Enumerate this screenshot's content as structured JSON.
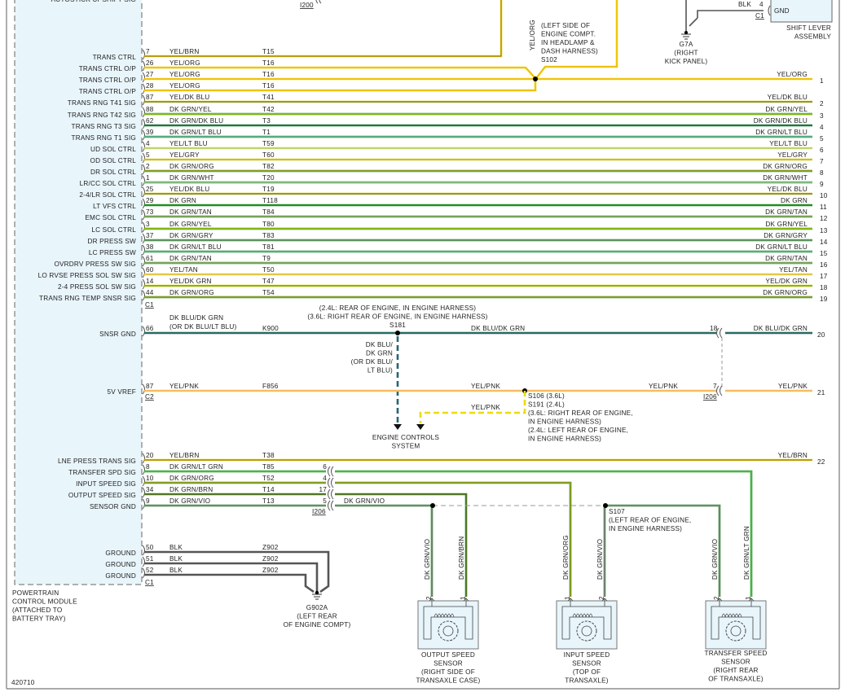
{
  "colors": {
    "YEL": "#ecdc00",
    "ORG": "#f5a623",
    "BRN": "#8b5a2b",
    "DK BLU": "#2a4f8f",
    "DK GRN": "#1f8f1f",
    "LT BLU": "#8ecae6",
    "GRY": "#9a9a9a",
    "WHT": "#e0e0e0",
    "TAN": "#d2b48c",
    "LT GRN": "#6fdc6f",
    "VIO": "#d070d0",
    "PNK": "#ff9ccc",
    "BLK": "#555555",
    "module_fill": "#e8f5fb"
  },
  "top": {
    "cut_label": "AUTOSTICK UPSHIFT SIG",
    "connector_i200": "I200",
    "splice_s102_note": [
      "(LEFT SIDE OF",
      "ENGINE COMPT.",
      "IN HEADLAMP &",
      "DASH HARNESS)",
      "S102"
    ],
    "vertical_color": "YEL/ORG",
    "ground_g7a": [
      "G7A",
      "(RIGHT",
      "KICK PANEL)"
    ],
    "shift_lever": {
      "wire_color": "BLK",
      "pin": "4",
      "pin_label": "GND",
      "connector": "C1",
      "name": [
        "SHIFT LEVER",
        "ASSEMBLY"
      ]
    }
  },
  "pcm": {
    "name": [
      "POWERTRAIN",
      "CONTROL MODULE",
      "(ATTACHED TO",
      "BATTERY TRAY)"
    ],
    "rows": [
      {
        "label": "TRANS CTRL",
        "pin": "7",
        "color": "YEL/BRN",
        "circuit": "T15"
      },
      {
        "label": "TRANS CTRL O/P",
        "pin": "26",
        "color": "YEL/ORG",
        "circuit": "T16"
      },
      {
        "label": "TRANS CTRL O/P",
        "pin": "27",
        "color": "YEL/ORG",
        "circuit": "T16",
        "right_color": "YEL/ORG",
        "right_num": "1"
      },
      {
        "label": "TRANS CTRL O/P",
        "pin": "28",
        "color": "YEL/ORG",
        "circuit": "T16"
      },
      {
        "label": "TRANS RNG T41 SIG",
        "pin": "87",
        "color": "YEL/DK BLU",
        "circuit": "T41",
        "right_color": "YEL/DK BLU",
        "right_num": "2"
      },
      {
        "label": "TRANS RNG T42 SIG",
        "pin": "88",
        "color": "DK GRN/YEL",
        "circuit": "T42",
        "right_color": "DK GRN/YEL",
        "right_num": "3"
      },
      {
        "label": "TRANS RNG T3 SIG",
        "pin": "62",
        "color": "DK GRN/DK BLU",
        "circuit": "T3",
        "right_color": "DK GRN/DK BLU",
        "right_num": "4"
      },
      {
        "label": "TRANS RNG T1 SIG",
        "pin": "39",
        "color": "DK GRN/LT BLU",
        "circuit": "T1",
        "right_color": "DK GRN/LT BLU",
        "right_num": "5"
      },
      {
        "label": "UD SOL CTRL",
        "pin": "4",
        "color": "YEL/LT BLU",
        "circuit": "T59",
        "right_color": "YEL/LT BLU",
        "right_num": "6"
      },
      {
        "label": "OD SOL CTRL",
        "pin": "5",
        "color": "YEL/GRY",
        "circuit": "T60",
        "right_color": "YEL/GRY",
        "right_num": "7"
      },
      {
        "label": "DR SOL CTRL",
        "pin": "2",
        "color": "DK GRN/ORG",
        "circuit": "T82",
        "right_color": "DK GRN/ORG",
        "right_num": "8"
      },
      {
        "label": "LR/CC SOL CTRL",
        "pin": "1",
        "color": "DK GRN/WHT",
        "circuit": "T20",
        "right_color": "DK GRN/WHT",
        "right_num": "9"
      },
      {
        "label": "2-4/LR SOL CTRL",
        "pin": "25",
        "color": "YEL/DK BLU",
        "circuit": "T19",
        "right_color": "YEL/DK BLU",
        "right_num": "10"
      },
      {
        "label": "LT VFS CTRL",
        "pin": "29",
        "color": "DK GRN",
        "circuit": "T118",
        "right_color": "DK GRN",
        "right_num": "11"
      },
      {
        "label": "EMC SOL CTRL",
        "pin": "73",
        "color": "DK GRN/TAN",
        "circuit": "T84",
        "right_color": "DK GRN/TAN",
        "right_num": "12"
      },
      {
        "label": "LC SOL CTRL",
        "pin": "3",
        "color": "DK GRN/YEL",
        "circuit": "T80",
        "right_color": "DK GRN/YEL",
        "right_num": "13"
      },
      {
        "label": "DR PRESS SW",
        "pin": "37",
        "color": "DK GRN/GRY",
        "circuit": "T83",
        "right_color": "DK GRN/GRY",
        "right_num": "14"
      },
      {
        "label": "LC PRESS SW",
        "pin": "38",
        "color": "DK GRN/LT BLU",
        "circuit": "T81",
        "right_color": "DK GRN/LT BLU",
        "right_num": "15"
      },
      {
        "label": "OVRDRV PRESS SW SIG",
        "pin": "61",
        "color": "DK GRN/TAN",
        "circuit": "T9",
        "right_color": "DK GRN/TAN",
        "right_num": "16"
      },
      {
        "label": "LO RVSE PRESS SOL SW SIG",
        "pin": "60",
        "color": "YEL/TAN",
        "circuit": "T50",
        "right_color": "YEL/TAN",
        "right_num": "17"
      },
      {
        "label": "2-4 PRESS SOL SW SIG",
        "pin": "14",
        "color": "YEL/DK GRN",
        "circuit": "T47",
        "right_color": "YEL/DK GRN",
        "right_num": "18"
      },
      {
        "label": "TRANS RNG TEMP SNSR SIG",
        "pin": "44",
        "color": "DK GRN/ORG",
        "circuit": "T54",
        "right_color": "DK GRN/ORG",
        "right_num": "19"
      }
    ],
    "connector_c1": "C1",
    "connector_c2": "C2"
  },
  "snsr_gnd": {
    "label": "SNSR GND",
    "pin": "66",
    "color": "DK BLU/DK GRN",
    "alt_color": "(OR DK BLU/LT BLU)",
    "circuit": "K900",
    "splice_note": [
      "(2.4L: REAR OF ENGINE, IN ENGINE HARNESS)",
      "(3.6L: RIGHT REAR OF ENGINE, IN ENGINE HARNESS)",
      "S181"
    ],
    "mid_color": "DK BLU/DK GRN",
    "inline_pin": "18",
    "right_color": "DK BLU/DK GRN",
    "right_num": "20",
    "branch_color": [
      "DK BLU/",
      "DK GRN",
      "(OR DK BLU/",
      "LT BLU)"
    ]
  },
  "vref": {
    "label": "5V VREF",
    "pin": "87",
    "color": "YEL/PNK",
    "circuit": "F856",
    "mid_color": "YEL/PNK",
    "mid_color2": "YEL/PNK",
    "branch_color": "YEL/PNK",
    "inline_pin": "7",
    "connector": "I206",
    "right_color": "YEL/PNK",
    "right_num": "21",
    "splice_note": [
      "S106  (3.6L)",
      "S191  (2.4L)",
      "(3.6L: RIGHT REAR OF ENGINE,",
      "IN ENGINE HARNESS)",
      "(2.4L: LEFT REAR OF ENGINE,",
      "IN ENGINE HARNESS)"
    ]
  },
  "engine_controls": [
    "ENGINE CONTROLS",
    "SYSTEM"
  ],
  "speed": {
    "rows": [
      {
        "label": "LNE PRESS TRANS SIG",
        "pin": "20",
        "color": "YEL/BRN",
        "circuit": "T38",
        "right_color": "YEL/BRN",
        "right_num": "22"
      },
      {
        "label": "TRANSFER SPD SIG",
        "pin": "8",
        "color": "DK GRN/LT GRN",
        "circuit": "T85",
        "inline_pin": "6"
      },
      {
        "label": "INPUT SPEED SIG",
        "pin": "10",
        "color": "DK GRN/ORG",
        "circuit": "T52",
        "inline_pin": "4"
      },
      {
        "label": "OUTPUT SPEED SIG",
        "pin": "34",
        "color": "DK GRN/BRN",
        "circuit": "T14",
        "inline_pin": "17"
      },
      {
        "label": "SENSOR GND",
        "pin": "9",
        "color": "DK GRN/VIO",
        "circuit": "T13",
        "inline_pin": "5",
        "after_color": "DK GRN/VIO"
      }
    ],
    "connector": "I206",
    "splice_s107": [
      "S107",
      "(LEFT REAR OF ENGINE,",
      "IN ENGINE HARNESS)"
    ]
  },
  "grounds": {
    "rows": [
      {
        "label": "GROUND",
        "pin": "50",
        "color": "BLK",
        "circuit": "Z902"
      },
      {
        "label": "GROUND",
        "pin": "51",
        "color": "BLK",
        "circuit": "Z902"
      },
      {
        "label": "GROUND",
        "pin": "52",
        "color": "BLK",
        "circuit": "Z902"
      }
    ],
    "connector": "C1",
    "ground_name": [
      "G902A",
      "(LEFT REAR",
      "OF ENGINE COMPT)"
    ]
  },
  "sensors": [
    {
      "name": [
        "OUTPUT SPEED",
        "SENSOR",
        "(RIGHT SIDE OF",
        "TRANSAXLE CASE)"
      ],
      "left_pin": "2",
      "left_color": "DK GRN/VIO",
      "right_pin": "1",
      "right_color": "DK GRN/BRN"
    },
    {
      "name": [
        "INPUT SPEED",
        "SENSOR",
        "(TOP OF",
        "TRANSAXLE)"
      ],
      "left_pin": "1",
      "left_color": "DK GRN/ORG",
      "right_pin": "2",
      "right_color": "DK GRN/VIO"
    },
    {
      "name": [
        "TRANSFER SPEED",
        "SENSOR",
        "(RIGHT REAR",
        "OF TRANSAXLE)"
      ],
      "left_pin": "2",
      "left_color": "DK GRN/VIO",
      "right_pin": "1",
      "right_color": "DK GRN/LT GRN"
    }
  ],
  "figure_id": "420710"
}
